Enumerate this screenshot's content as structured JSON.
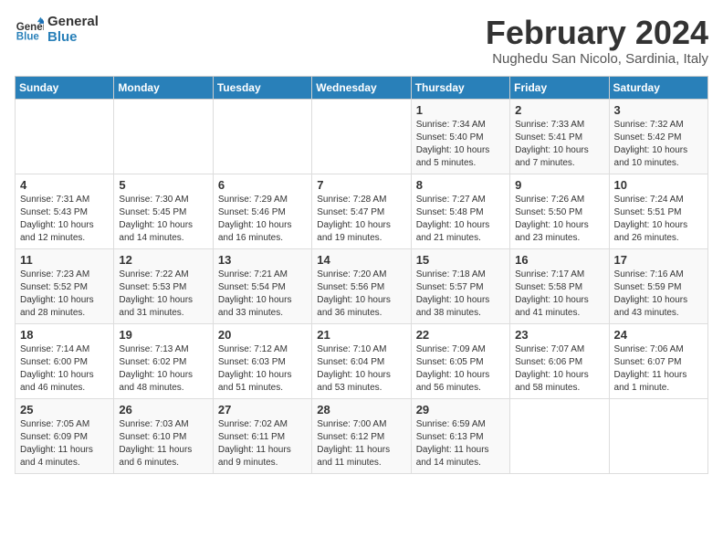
{
  "logo": {
    "line1": "General",
    "line2": "Blue"
  },
  "title": "February 2024",
  "subtitle": "Nughedu San Nicolo, Sardinia, Italy",
  "days_of_week": [
    "Sunday",
    "Monday",
    "Tuesday",
    "Wednesday",
    "Thursday",
    "Friday",
    "Saturday"
  ],
  "weeks": [
    [
      {
        "num": "",
        "info": ""
      },
      {
        "num": "",
        "info": ""
      },
      {
        "num": "",
        "info": ""
      },
      {
        "num": "",
        "info": ""
      },
      {
        "num": "1",
        "info": "Sunrise: 7:34 AM\nSunset: 5:40 PM\nDaylight: 10 hours\nand 5 minutes."
      },
      {
        "num": "2",
        "info": "Sunrise: 7:33 AM\nSunset: 5:41 PM\nDaylight: 10 hours\nand 7 minutes."
      },
      {
        "num": "3",
        "info": "Sunrise: 7:32 AM\nSunset: 5:42 PM\nDaylight: 10 hours\nand 10 minutes."
      }
    ],
    [
      {
        "num": "4",
        "info": "Sunrise: 7:31 AM\nSunset: 5:43 PM\nDaylight: 10 hours\nand 12 minutes."
      },
      {
        "num": "5",
        "info": "Sunrise: 7:30 AM\nSunset: 5:45 PM\nDaylight: 10 hours\nand 14 minutes."
      },
      {
        "num": "6",
        "info": "Sunrise: 7:29 AM\nSunset: 5:46 PM\nDaylight: 10 hours\nand 16 minutes."
      },
      {
        "num": "7",
        "info": "Sunrise: 7:28 AM\nSunset: 5:47 PM\nDaylight: 10 hours\nand 19 minutes."
      },
      {
        "num": "8",
        "info": "Sunrise: 7:27 AM\nSunset: 5:48 PM\nDaylight: 10 hours\nand 21 minutes."
      },
      {
        "num": "9",
        "info": "Sunrise: 7:26 AM\nSunset: 5:50 PM\nDaylight: 10 hours\nand 23 minutes."
      },
      {
        "num": "10",
        "info": "Sunrise: 7:24 AM\nSunset: 5:51 PM\nDaylight: 10 hours\nand 26 minutes."
      }
    ],
    [
      {
        "num": "11",
        "info": "Sunrise: 7:23 AM\nSunset: 5:52 PM\nDaylight: 10 hours\nand 28 minutes."
      },
      {
        "num": "12",
        "info": "Sunrise: 7:22 AM\nSunset: 5:53 PM\nDaylight: 10 hours\nand 31 minutes."
      },
      {
        "num": "13",
        "info": "Sunrise: 7:21 AM\nSunset: 5:54 PM\nDaylight: 10 hours\nand 33 minutes."
      },
      {
        "num": "14",
        "info": "Sunrise: 7:20 AM\nSunset: 5:56 PM\nDaylight: 10 hours\nand 36 minutes."
      },
      {
        "num": "15",
        "info": "Sunrise: 7:18 AM\nSunset: 5:57 PM\nDaylight: 10 hours\nand 38 minutes."
      },
      {
        "num": "16",
        "info": "Sunrise: 7:17 AM\nSunset: 5:58 PM\nDaylight: 10 hours\nand 41 minutes."
      },
      {
        "num": "17",
        "info": "Sunrise: 7:16 AM\nSunset: 5:59 PM\nDaylight: 10 hours\nand 43 minutes."
      }
    ],
    [
      {
        "num": "18",
        "info": "Sunrise: 7:14 AM\nSunset: 6:00 PM\nDaylight: 10 hours\nand 46 minutes."
      },
      {
        "num": "19",
        "info": "Sunrise: 7:13 AM\nSunset: 6:02 PM\nDaylight: 10 hours\nand 48 minutes."
      },
      {
        "num": "20",
        "info": "Sunrise: 7:12 AM\nSunset: 6:03 PM\nDaylight: 10 hours\nand 51 minutes."
      },
      {
        "num": "21",
        "info": "Sunrise: 7:10 AM\nSunset: 6:04 PM\nDaylight: 10 hours\nand 53 minutes."
      },
      {
        "num": "22",
        "info": "Sunrise: 7:09 AM\nSunset: 6:05 PM\nDaylight: 10 hours\nand 56 minutes."
      },
      {
        "num": "23",
        "info": "Sunrise: 7:07 AM\nSunset: 6:06 PM\nDaylight: 10 hours\nand 58 minutes."
      },
      {
        "num": "24",
        "info": "Sunrise: 7:06 AM\nSunset: 6:07 PM\nDaylight: 11 hours\nand 1 minute."
      }
    ],
    [
      {
        "num": "25",
        "info": "Sunrise: 7:05 AM\nSunset: 6:09 PM\nDaylight: 11 hours\nand 4 minutes."
      },
      {
        "num": "26",
        "info": "Sunrise: 7:03 AM\nSunset: 6:10 PM\nDaylight: 11 hours\nand 6 minutes."
      },
      {
        "num": "27",
        "info": "Sunrise: 7:02 AM\nSunset: 6:11 PM\nDaylight: 11 hours\nand 9 minutes."
      },
      {
        "num": "28",
        "info": "Sunrise: 7:00 AM\nSunset: 6:12 PM\nDaylight: 11 hours\nand 11 minutes."
      },
      {
        "num": "29",
        "info": "Sunrise: 6:59 AM\nSunset: 6:13 PM\nDaylight: 11 hours\nand 14 minutes."
      },
      {
        "num": "",
        "info": ""
      },
      {
        "num": "",
        "info": ""
      }
    ]
  ]
}
